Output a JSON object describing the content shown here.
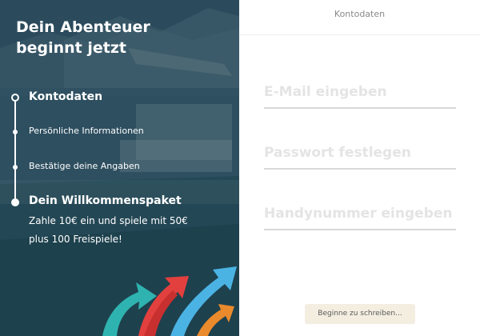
{
  "left_panel": {
    "title_line1": "Dein Abenteuer",
    "title_line2": "beginnt jetzt",
    "steps": [
      {
        "label": "Kontodaten",
        "state": "current"
      },
      {
        "label": "Persönliche Informationen",
        "state": "pending"
      },
      {
        "label": "Bestätige deine Angaben",
        "state": "pending"
      },
      {
        "label": "Dein Willkommenspaket",
        "state": "highlight"
      }
    ],
    "promo_line1": "Zahle 10€ ein und spiele mit 50€",
    "promo_line2": "plus 100 Freispiele!"
  },
  "right_panel": {
    "header": "Kontodaten",
    "fields": [
      {
        "placeholder": "E-Mail eingeben",
        "value": ""
      },
      {
        "placeholder": "Passwort festlegen",
        "value": ""
      },
      {
        "placeholder": "Handynummer eingeben",
        "value": ""
      }
    ],
    "cta_label": "Beginne zu schreiben..."
  },
  "colors": {
    "left_bg": "#2d4e60",
    "placeholder": "#e4e4e4",
    "underline": "#d9d9d9",
    "cta_bg": "#f4eee1"
  },
  "icons": [
    "step-ring-icon",
    "step-dot-icon",
    "arrows-decoration"
  ]
}
